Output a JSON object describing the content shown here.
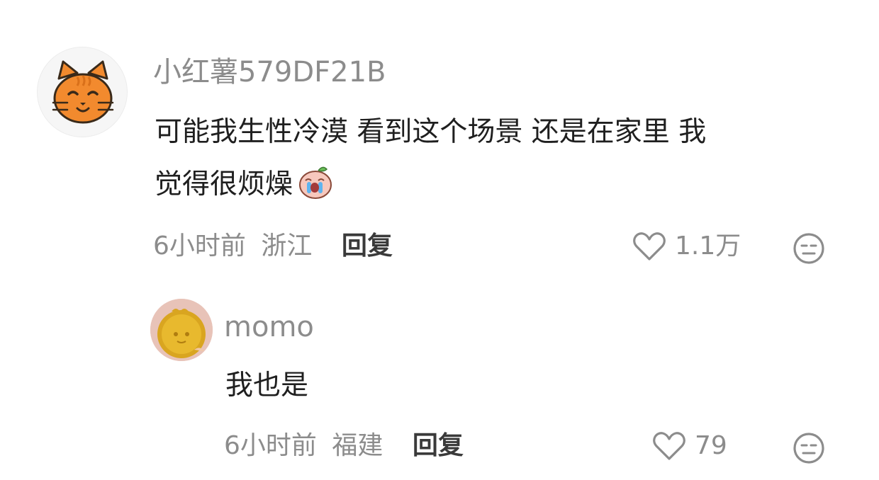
{
  "comment": {
    "username": "小红薯579DF21B",
    "text_line1": "可能我生性冷漠 看到这个场景 还是在家里 我",
    "text_line2": "觉得很烦燥",
    "time": "6小时前",
    "location": "浙江",
    "reply_label": "回复",
    "likes": "1.1万",
    "avatar_icon": "cat-face-icon",
    "inline_emoji": "crying-face-icon"
  },
  "reply": {
    "username": "momo",
    "text": "我也是",
    "time": "6小时前",
    "location": "福建",
    "reply_label": "回复",
    "likes": "79",
    "avatar_icon": "gold-medal-avatar"
  },
  "colors": {
    "meta_gray": "#8c8c8c",
    "text_dark": "#1f1f1f",
    "cat_orange": "#f28a2e"
  }
}
